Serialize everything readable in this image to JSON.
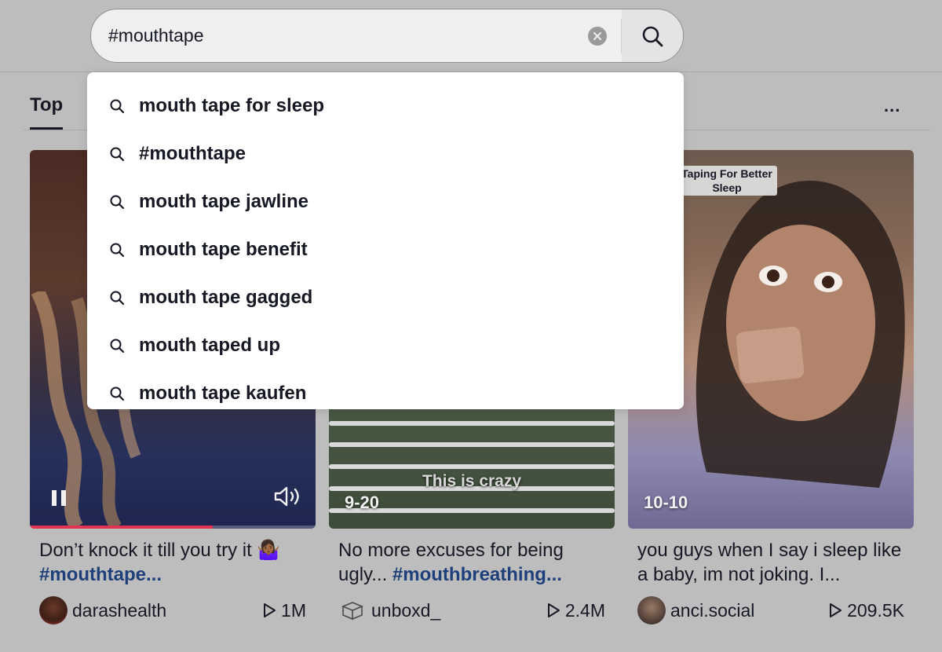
{
  "search": {
    "value": "#mouthtape",
    "clear_icon": "x-circle-icon",
    "submit_icon": "search-icon"
  },
  "tabs": {
    "active": "Top",
    "more_label": "..."
  },
  "suggestions": [
    "mouth tape for sleep",
    "#mouthtape",
    "mouth tape jawline",
    "mouth tape benefit",
    "mouth tape gagged",
    "mouth taped up",
    "mouth tape kaufen"
  ],
  "videos": [
    {
      "desc_text": "Don’t knock it till you try it 🤷🏾‍♀️",
      "desc_hashtag": "#mouthtape...",
      "username": "darashealth",
      "plays": "1M",
      "playback_progress": 0.64,
      "controls": [
        "pause-icon",
        "sound-icon"
      ]
    },
    {
      "caption": "This is crazy",
      "date": "9-20",
      "desc_text": "No more excuses for being ugly... ",
      "desc_hashtag": "#mouthbreathing...",
      "username": "unboxd_",
      "plays": "2.4M"
    },
    {
      "tag": "Taping For Better Sleep",
      "date": "10-10",
      "desc_text": "you guys when I say i sleep like a baby, im not joking. I...",
      "username": "anci.social",
      "plays": "209.5K"
    }
  ],
  "colors": {
    "background": "#bdbdbd",
    "hashtag": "#1f3f7a",
    "progress": "#e03452"
  }
}
